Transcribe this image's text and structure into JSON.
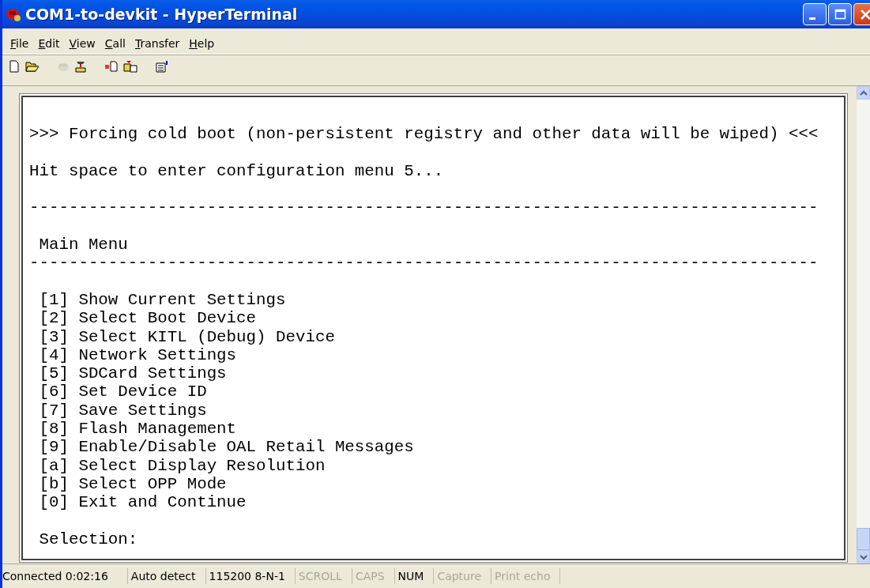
{
  "window": {
    "title": "COM1-to-devkit - HyperTerminal"
  },
  "menu": [
    {
      "label": "File"
    },
    {
      "label": "Edit"
    },
    {
      "label": "View"
    },
    {
      "label": "Call"
    },
    {
      "label": "Transfer"
    },
    {
      "label": "Help"
    }
  ],
  "toolbar": [
    {
      "kind": "new",
      "disabled": false
    },
    {
      "kind": "open",
      "disabled": false
    },
    {
      "kind": "connect",
      "disabled": true
    },
    {
      "kind": "disconnect",
      "disabled": false
    },
    {
      "kind": "send",
      "disabled": false
    },
    {
      "kind": "receive",
      "disabled": false
    },
    {
      "kind": "properties",
      "disabled": false
    }
  ],
  "terminal": {
    "lines": [
      {
        "kind": "blank"
      },
      {
        "kind": "text",
        "text": ">>> Forcing cold boot (non-persistent registry and other data will be wiped) <<<"
      },
      {
        "kind": "blank"
      },
      {
        "kind": "text",
        "text": "Hit space to enter configuration menu 5..."
      },
      {
        "kind": "blank"
      },
      {
        "kind": "text",
        "text": "--------------------------------------------------------------------------------"
      },
      {
        "kind": "blank"
      },
      {
        "kind": "text",
        "text": " Main Menu"
      },
      {
        "kind": "text",
        "text": "--------------------------------------------------------------------------------"
      },
      {
        "kind": "blank"
      },
      {
        "kind": "text",
        "text": " [1] Show Current Settings"
      },
      {
        "kind": "text",
        "text": " [2] Select Boot Device"
      },
      {
        "kind": "text",
        "text": " [3] Select KITL (Debug) Device"
      },
      {
        "kind": "text",
        "text": " [4] Network Settings"
      },
      {
        "kind": "text",
        "text": " [5] SDCard Settings"
      },
      {
        "kind": "text",
        "text": " [6] Set Device ID"
      },
      {
        "kind": "text",
        "text": " [7] Save Settings"
      },
      {
        "kind": "text",
        "text": " [8] Flash Management"
      },
      {
        "kind": "text",
        "text": " [9] Enable/Disable OAL Retail Messages"
      },
      {
        "kind": "text",
        "text": " [a] Select Display Resolution"
      },
      {
        "kind": "text",
        "text": " [b] Select OPP Mode"
      },
      {
        "kind": "text",
        "text": " [0] Exit and Continue"
      },
      {
        "kind": "blank"
      },
      {
        "kind": "text",
        "text": " Selection:"
      }
    ]
  },
  "status_bar": [
    {
      "text": "Connected 0:02:16",
      "active": true
    },
    {
      "text": "Auto detect",
      "active": true
    },
    {
      "text": "115200 8-N-1",
      "active": true
    },
    {
      "text": "SCROLL",
      "active": false
    },
    {
      "text": "CAPS",
      "active": false
    },
    {
      "text": "NUM",
      "active": true
    },
    {
      "text": "Capture",
      "active": false
    },
    {
      "text": "Print echo",
      "active": false
    }
  ]
}
